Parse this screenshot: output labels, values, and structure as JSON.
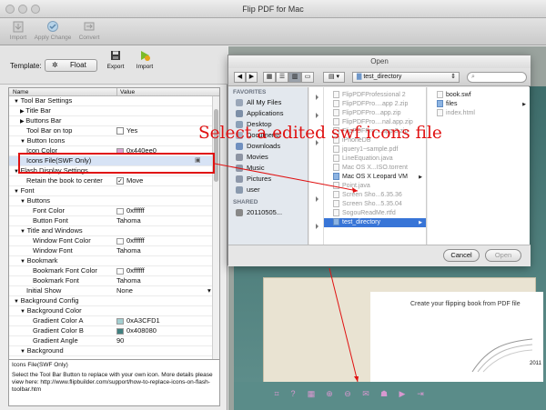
{
  "window": {
    "title": "Flip PDF for Mac"
  },
  "toolbar": {
    "items": [
      "Import",
      "Apply Change",
      "Convert"
    ]
  },
  "template_row": {
    "label": "Template:",
    "float_button": "Float",
    "export_label": "Export",
    "import_label": "Import"
  },
  "grid": {
    "headers": {
      "name": "Name",
      "value": "Value"
    },
    "rows": [
      {
        "name": "Tool Bar Settings",
        "value": "",
        "arrow": "▼",
        "indent": 1
      },
      {
        "name": "Title Bar",
        "value": "",
        "arrow": "▶",
        "indent": 2
      },
      {
        "name": "Buttons Bar",
        "value": "",
        "arrow": "▶",
        "indent": 2
      },
      {
        "name": "Tool Bar on top",
        "value": "Yes",
        "arrow": "",
        "indent": 3,
        "kind": "check",
        "checked": false
      },
      {
        "name": "Button Icons",
        "value": "",
        "arrow": "▼",
        "indent": 2
      },
      {
        "name": "Icon Color",
        "value": "0x440ee0",
        "arrow": "",
        "indent": 3,
        "kind": "swatch",
        "color": "#d8a0d0"
      },
      {
        "name": "Icons File(SWF Only)",
        "value": "",
        "arrow": "",
        "indent": 3,
        "kind": "selected"
      },
      {
        "name": "Flash Display Settings",
        "value": "",
        "arrow": "▼",
        "indent": 1
      },
      {
        "name": "Retain the book to center",
        "value": "Move",
        "arrow": "",
        "indent": 3,
        "kind": "check",
        "checked": true
      },
      {
        "name": "Font",
        "value": "",
        "arrow": "▼",
        "indent": 1
      },
      {
        "name": "Buttons",
        "value": "",
        "arrow": "▼",
        "indent": 2
      },
      {
        "name": "Font Color",
        "value": "0xffffff",
        "arrow": "",
        "indent": 4,
        "kind": "swatch",
        "color": "#ffffff"
      },
      {
        "name": "Button Font",
        "value": "Tahoma",
        "arrow": "",
        "indent": 4
      },
      {
        "name": "Title and Windows",
        "value": "",
        "arrow": "▼",
        "indent": 2
      },
      {
        "name": "Window Font Color",
        "value": "0xffffff",
        "arrow": "",
        "indent": 4,
        "kind": "swatch",
        "color": "#ffffff"
      },
      {
        "name": "Window Font",
        "value": "Tahoma",
        "arrow": "",
        "indent": 4
      },
      {
        "name": "Bookmark",
        "value": "",
        "arrow": "▼",
        "indent": 2
      },
      {
        "name": "Bookmark Font Color",
        "value": "0xffffff",
        "arrow": "",
        "indent": 4,
        "kind": "swatch",
        "color": "#ffffff"
      },
      {
        "name": "Bookmark Font",
        "value": "Tahoma",
        "arrow": "",
        "indent": 4
      },
      {
        "name": "Initial Show",
        "value": "None",
        "arrow": "",
        "indent": 3,
        "kind": "select"
      },
      {
        "name": "Background Config",
        "value": "",
        "arrow": "▼",
        "indent": 1
      },
      {
        "name": "Background Color",
        "value": "",
        "arrow": "▼",
        "indent": 2
      },
      {
        "name": "Gradient Color A",
        "value": "0xA3CFD1",
        "arrow": "",
        "indent": 4,
        "kind": "swatch",
        "color": "#a3cfd1"
      },
      {
        "name": "Gradient Color B",
        "value": "0x408080",
        "arrow": "",
        "indent": 4,
        "kind": "swatch",
        "color": "#408080"
      },
      {
        "name": "Gradient Angle",
        "value": "90",
        "arrow": "",
        "indent": 4
      },
      {
        "name": "Background",
        "value": "",
        "arrow": "▼",
        "indent": 2
      }
    ]
  },
  "description": {
    "title": "Icons File(SWF Only)",
    "text": "Select the Tool Bar Button to replace with your own icon. More details please view here: http://www.flipbuilder.com/support/how-to-replace-icons-on-flash-toolbar.htm"
  },
  "dialog": {
    "title": "Open",
    "location": "test_directory",
    "search_placeholder": "",
    "sidebar": {
      "favorites_header": "FAVORITES",
      "favorites": [
        {
          "label": "All My Files",
          "color": "#9aa6b8"
        },
        {
          "label": "Applications",
          "color": "#7d8fa8"
        },
        {
          "label": "Desktop",
          "color": "#8aa0b8"
        },
        {
          "label": "Documents",
          "color": "#a8b0c0"
        },
        {
          "label": "Downloads",
          "color": "#6f8fbf"
        },
        {
          "label": "Movies",
          "color": "#8d94a3"
        },
        {
          "label": "Music",
          "color": "#9098a8"
        },
        {
          "label": "Pictures",
          "color": "#8e98aa"
        },
        {
          "label": "user",
          "color": "#8a9aae"
        }
      ],
      "shared_header": "SHARED",
      "shared": [
        {
          "label": "20110505...",
          "color": "#888888"
        }
      ]
    },
    "column2": [
      {
        "label": "FlipPDFProfessional 2",
        "style": "dim"
      },
      {
        "label": "FlipPDFPro....app 2.zip",
        "style": "dim"
      },
      {
        "label": "FlipPDFPro...app.zip",
        "style": "dim"
      },
      {
        "label": "FlipPDFPro....nal.app.zip",
        "style": "dim"
      },
      {
        "label": "FlipPDFPro....app 3.zip",
        "style": "dim"
      },
      {
        "label": "iPhoneDB",
        "style": "dim"
      },
      {
        "label": "jquery1~sample.pdf",
        "style": "dim"
      },
      {
        "label": "LineEquation.java",
        "style": "dim"
      },
      {
        "label": "Mac OS X...ISO.torrent",
        "style": "dim"
      },
      {
        "label": "Mac OS X Leopard VM",
        "style": "dark-folder"
      },
      {
        "label": "Point.java",
        "style": "dim"
      },
      {
        "label": "Screen Sho...6.35.36",
        "style": "dim"
      },
      {
        "label": "Screen Sho...5.35.04",
        "style": "dim"
      },
      {
        "label": "SogouReadMe.rtfd",
        "style": "dim"
      },
      {
        "label": "test_directory",
        "style": "selected-folder"
      }
    ],
    "column3": [
      {
        "label": "book.swf",
        "style": "dark"
      },
      {
        "label": "files",
        "style": "dark-folder"
      },
      {
        "label": "index.html",
        "style": "dim"
      }
    ],
    "cancel_button": "Cancel",
    "open_button": "Open"
  },
  "annotation": {
    "text": "Select a edited swf icons file",
    "color": "#e01010"
  },
  "book": {
    "subtitle": "Create your flipping book from PDF file",
    "year": "2011"
  },
  "bottom_bar": {
    "icons": [
      "fit-icon",
      "help-icon",
      "grid-icon",
      "zoom-in-icon",
      "zoom-out-icon",
      "mail-icon",
      "gift-icon",
      "next-icon",
      "last-icon"
    ]
  }
}
